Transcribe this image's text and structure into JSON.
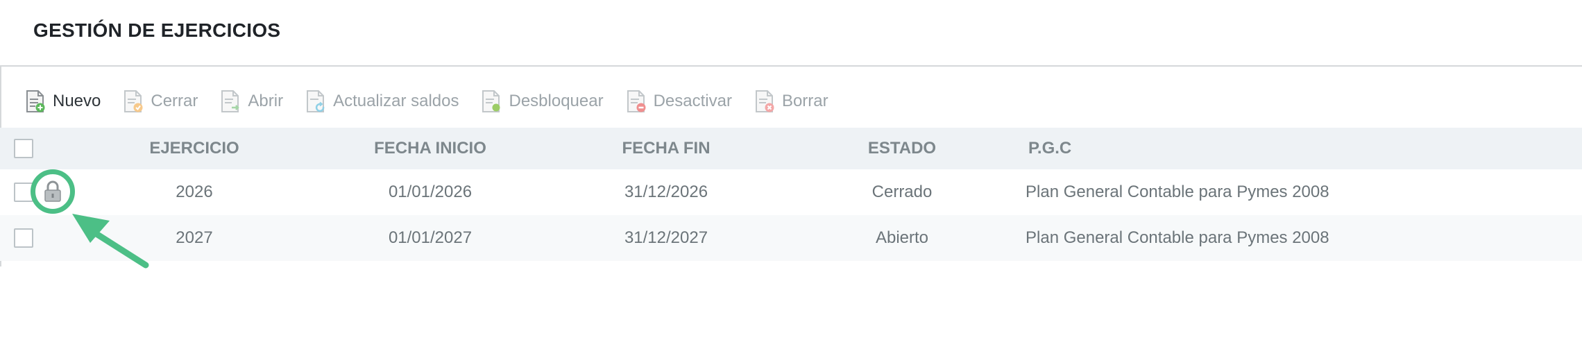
{
  "page": {
    "title": "GESTIÓN DE EJERCICIOS"
  },
  "toolbar": {
    "items": [
      {
        "label": "Nuevo",
        "icon": "doc-add-icon",
        "enabled": true,
        "accent": "#5cb85c"
      },
      {
        "label": "Cerrar",
        "icon": "doc-close-icon",
        "enabled": false,
        "accent": "#f0ad4e"
      },
      {
        "label": "Abrir",
        "icon": "doc-open-icon",
        "enabled": false,
        "accent": "#a5d6a7"
      },
      {
        "label": "Actualizar saldos",
        "icon": "doc-refresh-icon",
        "enabled": false,
        "accent": "#5bc0de"
      },
      {
        "label": "Desbloquear",
        "icon": "doc-unlock-icon",
        "enabled": false,
        "accent": "#8bc34a"
      },
      {
        "label": "Desactivar",
        "icon": "doc-deactivate-icon",
        "enabled": false,
        "accent": "#e57373"
      },
      {
        "label": "Borrar",
        "icon": "doc-delete-icon",
        "enabled": false,
        "accent": "#ef9a9a"
      }
    ]
  },
  "table": {
    "headers": {
      "ejercicio": "EJERCICIO",
      "fecha_inicio": "FECHA INICIO",
      "fecha_fin": "FECHA FIN",
      "estado": "ESTADO",
      "pgc": "P.G.C"
    },
    "rows": [
      {
        "ejercicio": "2026",
        "fecha_inicio": "01/01/2026",
        "fecha_fin": "31/12/2026",
        "estado": "Cerrado",
        "pgc": "Plan General Contable para Pymes 2008",
        "locked": true
      },
      {
        "ejercicio": "2027",
        "fecha_inicio": "01/01/2027",
        "fecha_fin": "31/12/2027",
        "estado": "Abierto",
        "pgc": "Plan General Contable para Pymes 2008",
        "locked": false
      }
    ]
  },
  "annotation": {
    "highlight_color": "#4cbf86",
    "target_icon": "lock-icon"
  }
}
